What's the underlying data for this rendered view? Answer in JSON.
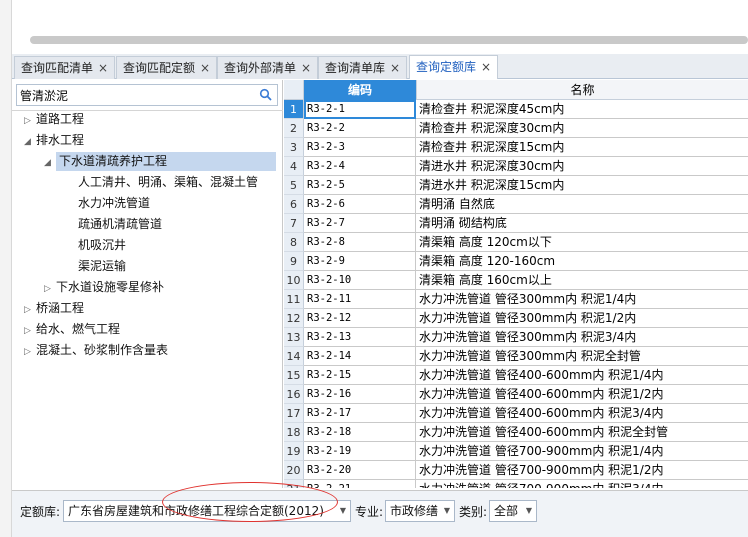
{
  "tabs": [
    {
      "label": "查询匹配清单",
      "active": false
    },
    {
      "label": "查询匹配定额",
      "active": false
    },
    {
      "label": "查询外部清单",
      "active": false
    },
    {
      "label": "查询清单库",
      "active": false
    },
    {
      "label": "查询定额库",
      "active": true
    }
  ],
  "close_glyph": "×",
  "search": {
    "value": "管清淤泥",
    "placeholder": ""
  },
  "tree": [
    {
      "label": "道路工程",
      "arrow": "▷",
      "level": 0
    },
    {
      "label": "排水工程",
      "arrow": "◢",
      "level": 0
    },
    {
      "label": "下水道清疏养护工程",
      "arrow": "◢",
      "level": 1,
      "selected": true
    },
    {
      "label": "人工清井、明涌、渠箱、混凝土管",
      "arrow": "",
      "level": 2
    },
    {
      "label": "水力冲洗管道",
      "arrow": "",
      "level": 2
    },
    {
      "label": "疏通机清疏管道",
      "arrow": "",
      "level": 2
    },
    {
      "label": "机吸沉井",
      "arrow": "",
      "level": 2
    },
    {
      "label": "渠泥运输",
      "arrow": "",
      "level": 2
    },
    {
      "label": "下水道设施零星修补",
      "arrow": "▷",
      "level": 1
    },
    {
      "label": "桥涵工程",
      "arrow": "▷",
      "level": 0
    },
    {
      "label": "给水、燃气工程",
      "arrow": "▷",
      "level": 0
    },
    {
      "label": "混凝土、砂浆制作含量表",
      "arrow": "▷",
      "level": 0
    }
  ],
  "grid": {
    "headers": {
      "code": "编码",
      "name": "名称"
    },
    "rows": [
      {
        "num": "1",
        "code": "R3-2-1",
        "name": "清检查井 积泥深度45cm内"
      },
      {
        "num": "2",
        "code": "R3-2-2",
        "name": "清检查井 积泥深度30cm内"
      },
      {
        "num": "3",
        "code": "R3-2-3",
        "name": "清检查井 积泥深度15cm内"
      },
      {
        "num": "4",
        "code": "R3-2-4",
        "name": "清进水井 积泥深度30cm内"
      },
      {
        "num": "5",
        "code": "R3-2-5",
        "name": "清进水井 积泥深度15cm内"
      },
      {
        "num": "6",
        "code": "R3-2-6",
        "name": "清明涌 自然底"
      },
      {
        "num": "7",
        "code": "R3-2-7",
        "name": "清明涌 砌结构底"
      },
      {
        "num": "8",
        "code": "R3-2-8",
        "name": "清渠箱 高度 120cm以下"
      },
      {
        "num": "9",
        "code": "R3-2-9",
        "name": "清渠箱 高度 120-160cm"
      },
      {
        "num": "10",
        "code": "R3-2-10",
        "name": "清渠箱 高度 160cm以上"
      },
      {
        "num": "11",
        "code": "R3-2-11",
        "name": "水力冲洗管道 管径300mm内 积泥1/4内"
      },
      {
        "num": "12",
        "code": "R3-2-12",
        "name": "水力冲洗管道 管径300mm内 积泥1/2内"
      },
      {
        "num": "13",
        "code": "R3-2-13",
        "name": "水力冲洗管道 管径300mm内 积泥3/4内"
      },
      {
        "num": "14",
        "code": "R3-2-14",
        "name": "水力冲洗管道 管径300mm内 积泥全封管"
      },
      {
        "num": "15",
        "code": "R3-2-15",
        "name": "水力冲洗管道 管径400-600mm内 积泥1/4内"
      },
      {
        "num": "16",
        "code": "R3-2-16",
        "name": "水力冲洗管道 管径400-600mm内 积泥1/2内"
      },
      {
        "num": "17",
        "code": "R3-2-17",
        "name": "水力冲洗管道 管径400-600mm内 积泥3/4内"
      },
      {
        "num": "18",
        "code": "R3-2-18",
        "name": "水力冲洗管道 管径400-600mm内 积泥全封管"
      },
      {
        "num": "19",
        "code": "R3-2-19",
        "name": "水力冲洗管道 管径700-900mm内 积泥1/4内"
      },
      {
        "num": "20",
        "code": "R3-2-20",
        "name": "水力冲洗管道 管径700-900mm内 积泥1/2内"
      },
      {
        "num": "21",
        "code": "R3-2-21",
        "name": "水力冲洗管道 管径700-900mm内 积泥3/4内"
      }
    ]
  },
  "bottom": {
    "quota_label": "定额库:",
    "quota_value": "广东省房屋建筑和市政修缮工程综合定额(2012)",
    "specialty_label": "专业:",
    "specialty_value": "市政修缮",
    "category_label": "类别:",
    "category_value": "全部"
  },
  "colors": {
    "accent": "#2e89d9",
    "annotation": "#e0332f",
    "selected_tree": "#c5d7ee"
  }
}
